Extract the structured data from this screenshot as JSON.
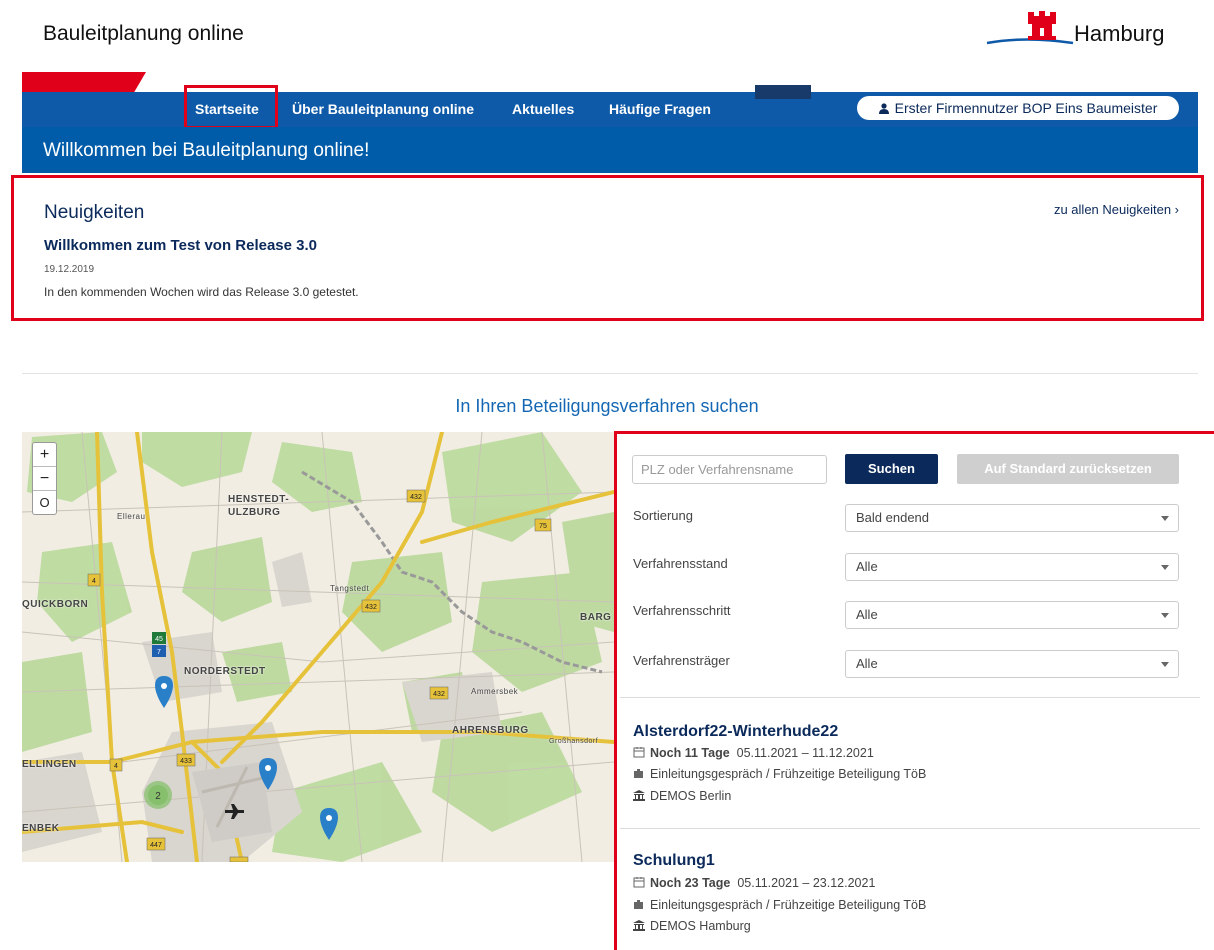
{
  "header": {
    "site_title": "Bauleitplanung online",
    "logo_text": "Hamburg"
  },
  "nav": {
    "items": [
      {
        "label": "Startseite"
      },
      {
        "label": "Über Bauleitplanung online"
      },
      {
        "label": "Aktuelles"
      },
      {
        "label": "Häufige Fragen"
      }
    ],
    "user_label": "Erster Firmennutzer BOP Eins Baumeister"
  },
  "welcome": {
    "text": "Willkommen bei Bauleitplanung online!"
  },
  "news": {
    "title": "Neuigkeiten",
    "all_link": "zu allen Neuigkeiten ›",
    "headline": "Willkommen zum Test von Release 3.0",
    "date": "19.12.2019",
    "body": "In den kommenden Wochen wird das Release 3.0 getestet."
  },
  "search": {
    "heading": "In Ihren Beteiligungsverfahren suchen",
    "placeholder": "PLZ oder Verfahrensname",
    "search_button": "Suchen",
    "reset_button": "Auf Standard zurücksetzen"
  },
  "map": {
    "zoom_in": "+",
    "zoom_out": "−",
    "reset": "O",
    "labels": {
      "henstedt": "HENSTEDT-",
      "ulzburg": "ULZBURG",
      "quickborn": "QUICKBORN",
      "norderstedt": "NORDERSTEDT",
      "ahrensburg": "AHRENSBURG",
      "ellingen": "ELLINGEN",
      "enbek": "ENBEK",
      "barg": "BARG",
      "ellerau": "Ellerau",
      "tangstedt": "Tangstedt",
      "ammersbek": "Ammersbek",
      "grosshansdorf": "Großhansdorf"
    },
    "road_numbers": {
      "r432a": "432",
      "r432b": "432",
      "r432c": "432",
      "r433": "433",
      "r75": "75",
      "r4a": "4",
      "r4b": "4",
      "r447": "447",
      "r45": "45",
      "r7": "7"
    },
    "cluster_count": "2",
    "colors": {
      "marker": "#2a7fc9",
      "cluster": "#86c06c"
    }
  },
  "filters": [
    {
      "label": "Sortierung",
      "value": "Bald endend"
    },
    {
      "label": "Verfahrensstand",
      "value": "Alle"
    },
    {
      "label": "Verfahrensschritt",
      "value": "Alle"
    },
    {
      "label": "Verfahrensträger",
      "value": "Alle"
    }
  ],
  "procedures": [
    {
      "title": "Alsterdorf22-Winterhude22",
      "remaining": "Noch 11 Tage",
      "dates": "05.11.2021 – 11.12.2021",
      "step": "Einleitungsgespräch / Frühzeitige Beteiligung TöB",
      "authority": "DEMOS Berlin"
    },
    {
      "title": "Schulung1",
      "remaining": "Noch 23 Tage",
      "dates": "05.11.2021 – 23.12.2021",
      "step": "Einleitungsgespräch / Frühzeitige Beteiligung TöB",
      "authority": "DEMOS Hamburg"
    }
  ],
  "colors": {
    "primary": "#005ca9",
    "nav": "#0f5aa8",
    "navy": "#0b2a5b",
    "accent_red": "#e1001a",
    "disabled": "#cfcfcf"
  }
}
